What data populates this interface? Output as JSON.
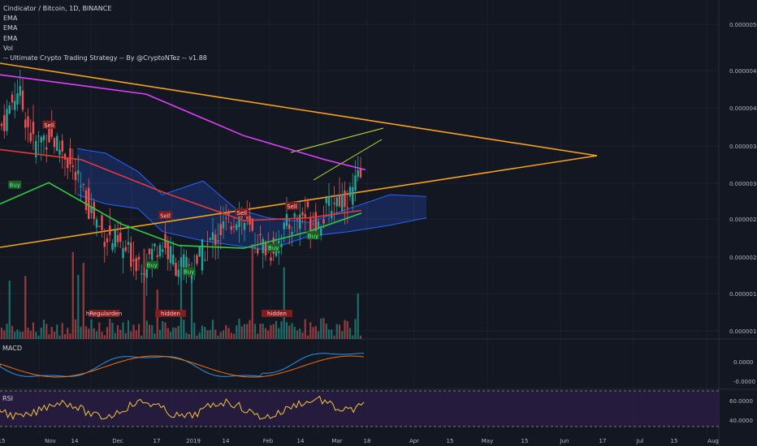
{
  "legend": {
    "title": "Cindicator / Bitcoin, 1D, BINANCE",
    "items": [
      "EMA",
      "EMA",
      "EMA",
      "Vol",
      "-- Ultimate Crypto Trading Strategy -- By @CryptoNTez -- v1.88"
    ]
  },
  "panes": {
    "macd_label": "MACD",
    "rsi_label": "RSI"
  },
  "chart_data": {
    "type": "candlestick",
    "symbol": "Cindicator / Bitcoin",
    "interval": "1D",
    "exchange": "BINANCE",
    "price_axis_labels": [
      "0.00000500",
      "0.00000450",
      "0.00000400",
      "0.00000350",
      "0.00000300",
      "0.00000250",
      "0.00000200",
      "0.00000150",
      "0.00000100"
    ],
    "macd_axis_labels": [
      "0.0000",
      "-0.0000"
    ],
    "rsi_axis_labels": [
      "60.0000",
      "40.0000"
    ],
    "time_axis_labels": [
      "15",
      "Nov",
      "14",
      "Dec",
      "17",
      "2019",
      "14",
      "Feb",
      "14",
      "Mar",
      "18",
      "Apr",
      "15",
      "May",
      "15",
      "Jun",
      "17",
      "Jul",
      "15",
      "Aug"
    ],
    "price_range": [
      2.15e-06,
      5.2e-06
    ],
    "price_series": [
      {
        "name": "EMA",
        "color": "#e040fb",
        "points": [
          [
            0,
            4.75e-06
          ],
          [
            180,
            4.54e-06
          ],
          [
            300,
            4.09e-06
          ],
          [
            400,
            3.83e-06
          ],
          [
            450,
            3.72e-06
          ]
        ]
      },
      {
        "name": "EMA",
        "color": "#e53935",
        "points": [
          [
            0,
            3.94e-06
          ],
          [
            100,
            3.83e-06
          ],
          [
            200,
            3.48e-06
          ],
          [
            300,
            3.17e-06
          ],
          [
            380,
            3.2e-06
          ],
          [
            445,
            3.28e-06
          ]
        ]
      },
      {
        "name": "EMA",
        "color": "#2ecc40",
        "points": [
          [
            0,
            3.35e-06
          ],
          [
            60,
            3.58e-06
          ],
          [
            150,
            3.13e-06
          ],
          [
            220,
            2.9e-06
          ],
          [
            300,
            2.87e-06
          ],
          [
            380,
            3.05e-06
          ],
          [
            445,
            3.25e-06
          ]
        ]
      }
    ],
    "signals": [
      {
        "label": "Buy",
        "date_index": 5,
        "price": 3.55e-06
      },
      {
        "label": "Sell",
        "date_index": 18,
        "price": 4.2e-06
      },
      {
        "label": "Sell",
        "date_index": 62,
        "price": 3.22e-06
      },
      {
        "label": "Buy",
        "date_index": 57,
        "price": 2.68e-06
      },
      {
        "label": "Buy",
        "date_index": 71,
        "price": 2.61e-06
      },
      {
        "label": "Sell",
        "date_index": 91,
        "price": 3.25e-06
      },
      {
        "label": "Buy",
        "date_index": 103,
        "price": 2.87e-06
      },
      {
        "label": "Sell",
        "date_index": 110,
        "price": 3.32e-06
      },
      {
        "label": "Buy",
        "date_index": 118,
        "price": 3e-06
      }
    ],
    "volume_tags": [
      "hRegularden",
      "hidden",
      "hidden"
    ],
    "grid": true
  },
  "colors": {
    "background": "#131722",
    "up": "#26a69a",
    "down": "#ef5350",
    "trendline": "#f7a21b",
    "cloud": "#2962ff",
    "macd": "#2196f3",
    "signal": "#ff6d00",
    "rsi": "#f5c542",
    "rsi_band": "#2a1d45"
  }
}
